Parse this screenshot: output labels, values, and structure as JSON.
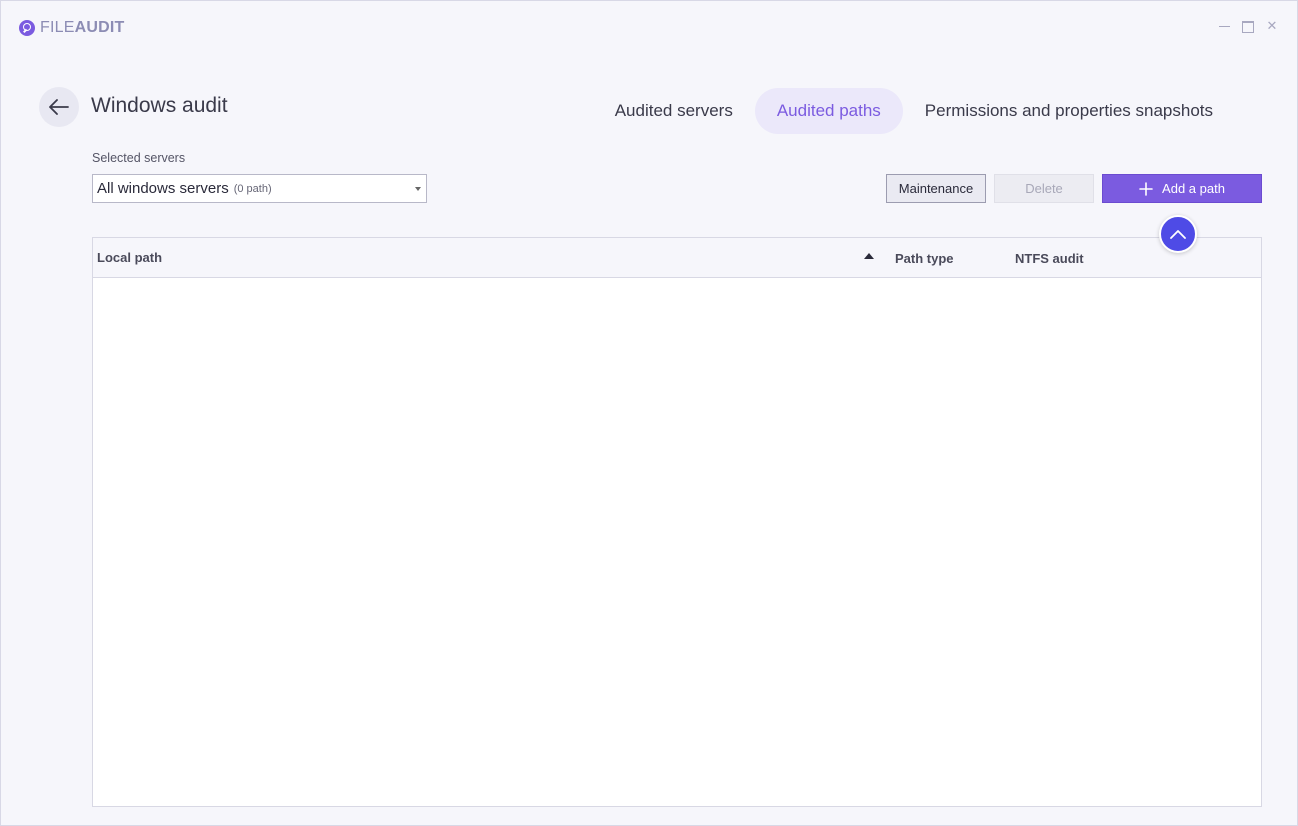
{
  "app": {
    "logo_light": "FILE",
    "logo_bold": "AUDIT",
    "window_close": "✕"
  },
  "header": {
    "title": "Windows audit"
  },
  "tabs": [
    {
      "label": "Audited servers"
    },
    {
      "label": "Audited paths"
    },
    {
      "label": "Permissions and properties snapshots"
    }
  ],
  "selector": {
    "label": "Selected servers",
    "value": "All windows servers",
    "count": "(0 path)"
  },
  "actions": {
    "maintenance": "Maintenance",
    "delete": "Delete",
    "add": "Add a path"
  },
  "table": {
    "columns": [
      "Local path",
      "Path type",
      "NTFS audit"
    ],
    "rows": []
  },
  "colors": {
    "accent": "#7b5be0",
    "scroll_button": "#4e4be6"
  }
}
